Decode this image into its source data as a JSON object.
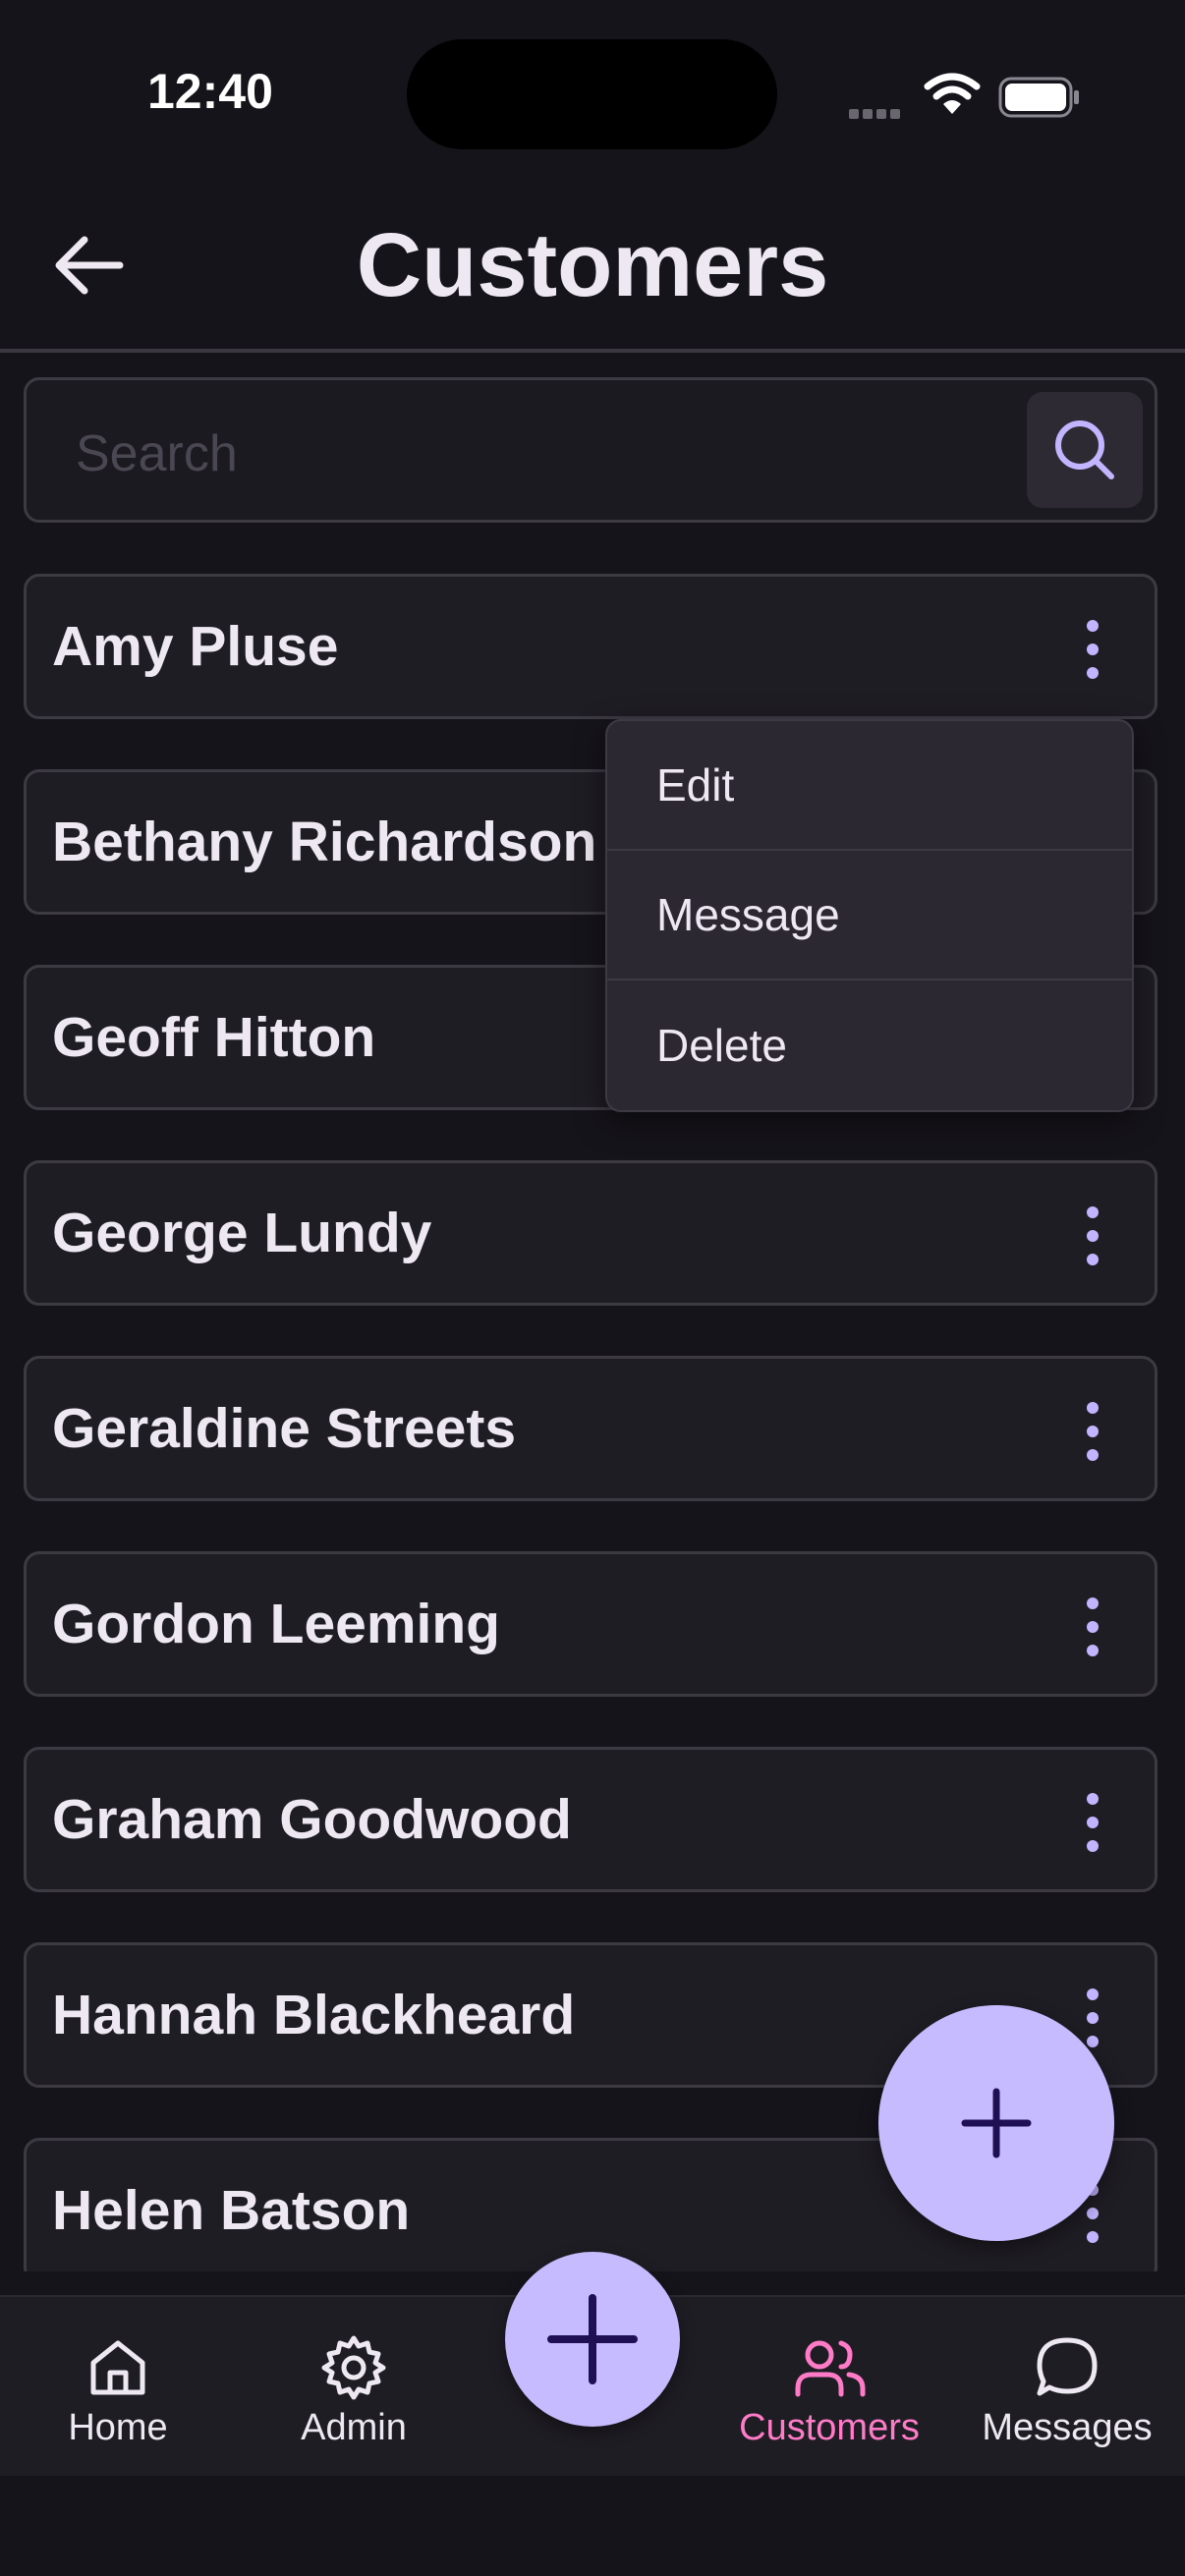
{
  "status_bar": {
    "time": "12:40"
  },
  "header": {
    "title": "Customers"
  },
  "search": {
    "placeholder": "Search",
    "value": ""
  },
  "customers": [
    {
      "name": "Amy Pluse"
    },
    {
      "name": "Bethany Richardson"
    },
    {
      "name": "Geoff Hitton"
    },
    {
      "name": "George Lundy"
    },
    {
      "name": "Geraldine Streets"
    },
    {
      "name": "Gordon Leeming"
    },
    {
      "name": "Graham Goodwood"
    },
    {
      "name": "Hannah Blackheard"
    },
    {
      "name": "Helen Batson"
    }
  ],
  "context_menu": {
    "items": [
      {
        "label": "Edit"
      },
      {
        "label": "Message"
      },
      {
        "label": "Delete"
      }
    ]
  },
  "bottom_nav": {
    "items": [
      {
        "label": "Home",
        "icon": "home-icon"
      },
      {
        "label": "Admin",
        "icon": "gear-icon"
      },
      {
        "label": "Customers",
        "icon": "users-icon",
        "active": true
      },
      {
        "label": "Messages",
        "icon": "chat-bubble-icon"
      }
    ]
  },
  "colors": {
    "background": "#16141b",
    "accent": "#c7bbff",
    "active_nav": "#ff7bc8"
  }
}
